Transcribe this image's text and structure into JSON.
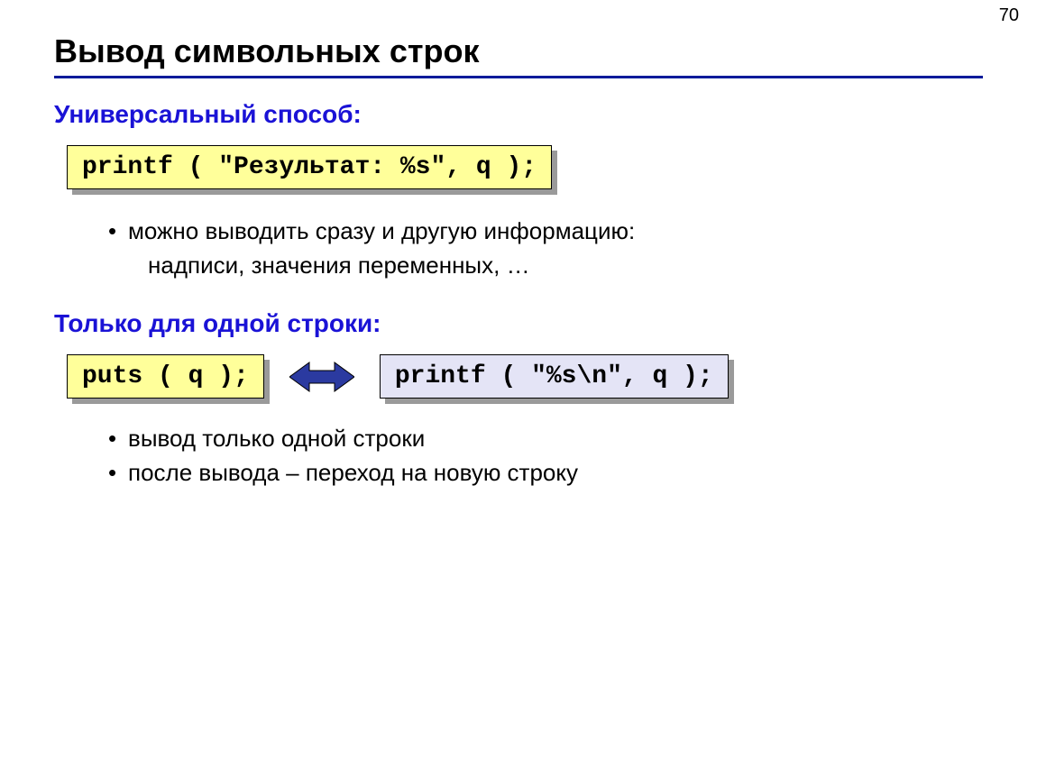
{
  "page_number": "70",
  "title": "Вывод символьных строк",
  "section1": {
    "heading": "Универсальный способ:",
    "code": "printf ( \"Результат: %s\", q );",
    "bullet1_line1": "можно выводить сразу и другую информацию:",
    "bullet1_line2": "надписи, значения переменных, …"
  },
  "section2": {
    "heading": "Только для одной строки:",
    "code_left": "puts ( q );",
    "code_right": "printf ( \"%s\\n\", q );",
    "bullet1": "вывод только одной строки",
    "bullet2": "после вывода – переход на новую строку"
  }
}
